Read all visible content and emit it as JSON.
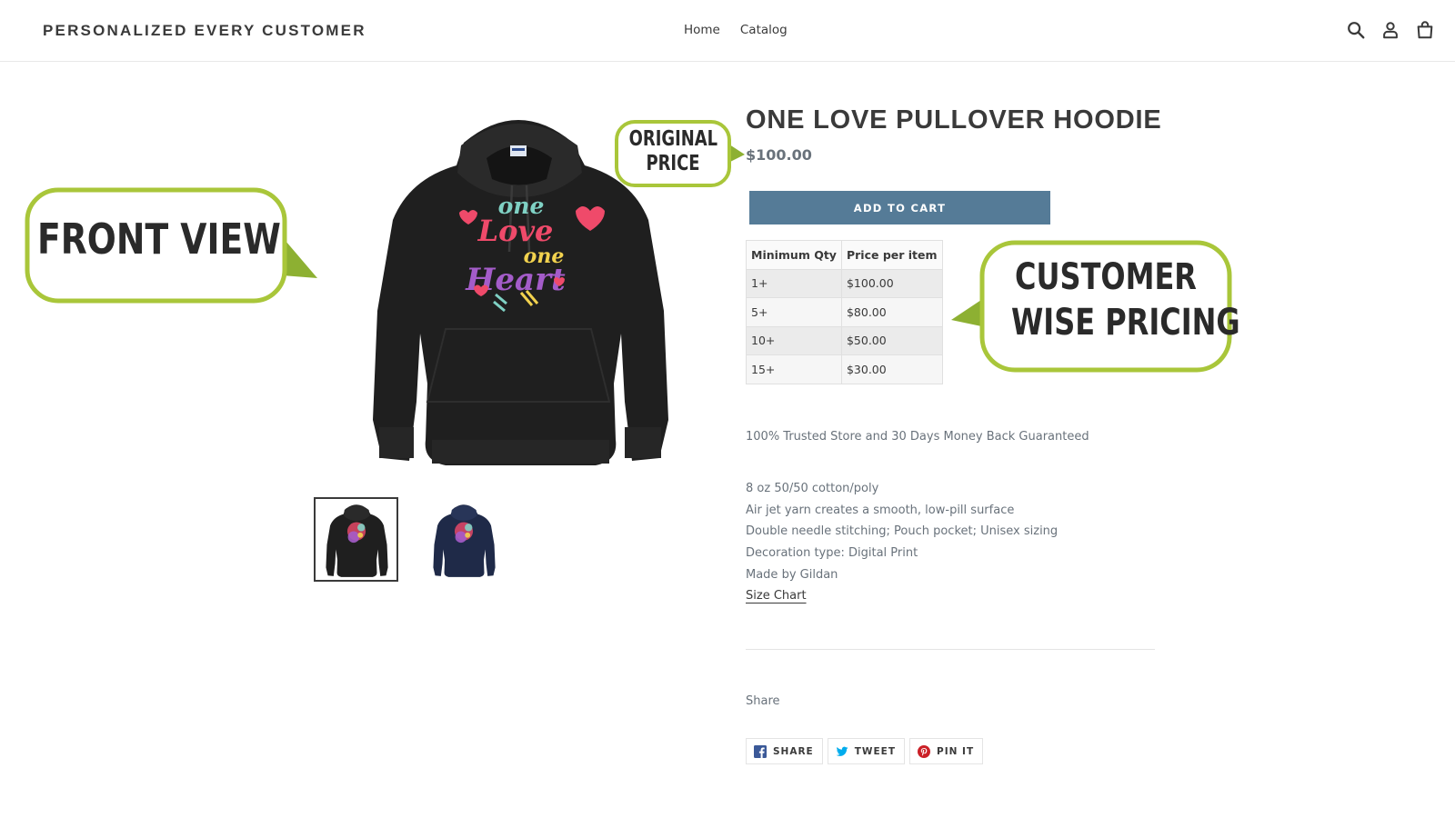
{
  "header": {
    "logo": "PERSONALIZED EVERY CUSTOMER",
    "nav": [
      "Home",
      "Catalog"
    ],
    "icons": [
      "search-icon",
      "account-icon",
      "cart-icon"
    ]
  },
  "callouts": {
    "front_view": "Front View",
    "original_price_line1": "Original",
    "original_price_line2": "Price",
    "customer_pricing_line1": "Customer",
    "customer_pricing_line2": "wise pricing"
  },
  "product": {
    "title": "ONE LOVE PULLOVER HOODIE",
    "price": "$100.00",
    "add_to_cart": "ADD TO CART",
    "artwork_lines": [
      "one",
      "Love",
      "one",
      "Heart"
    ],
    "thumbnails": [
      {
        "color": "black",
        "active": true
      },
      {
        "color": "navy",
        "active": false
      }
    ]
  },
  "pricing_table": {
    "headers": [
      "Minimum Qty",
      "Price per item"
    ],
    "rows": [
      [
        "1+",
        "$100.00"
      ],
      [
        "5+",
        "$80.00"
      ],
      [
        "10+",
        "$50.00"
      ],
      [
        "15+",
        "$30.00"
      ]
    ]
  },
  "guarantee": "100% Trusted Store and 30 Days Money Back Guaranteed",
  "features": [
    "8 oz 50/50 cotton/poly",
    "Air jet yarn creates a smooth, low-pill surface",
    "Double needle stitching; Pouch pocket; Unisex sizing",
    "Decoration type: Digital Print",
    "Made by Gildan"
  ],
  "size_chart": "Size Chart",
  "share": {
    "label": "Share",
    "buttons": [
      {
        "label": "SHARE",
        "icon": "facebook-icon",
        "color": "#3b5998"
      },
      {
        "label": "TWEET",
        "icon": "twitter-icon",
        "color": "#00aced"
      },
      {
        "label": "PIN IT",
        "icon": "pinterest-icon",
        "color": "#cb2027"
      }
    ]
  },
  "colors": {
    "accent": "#557b97",
    "callout_border": "#a9c63a",
    "text": "#3a3a3a",
    "muted": "#69727b"
  }
}
